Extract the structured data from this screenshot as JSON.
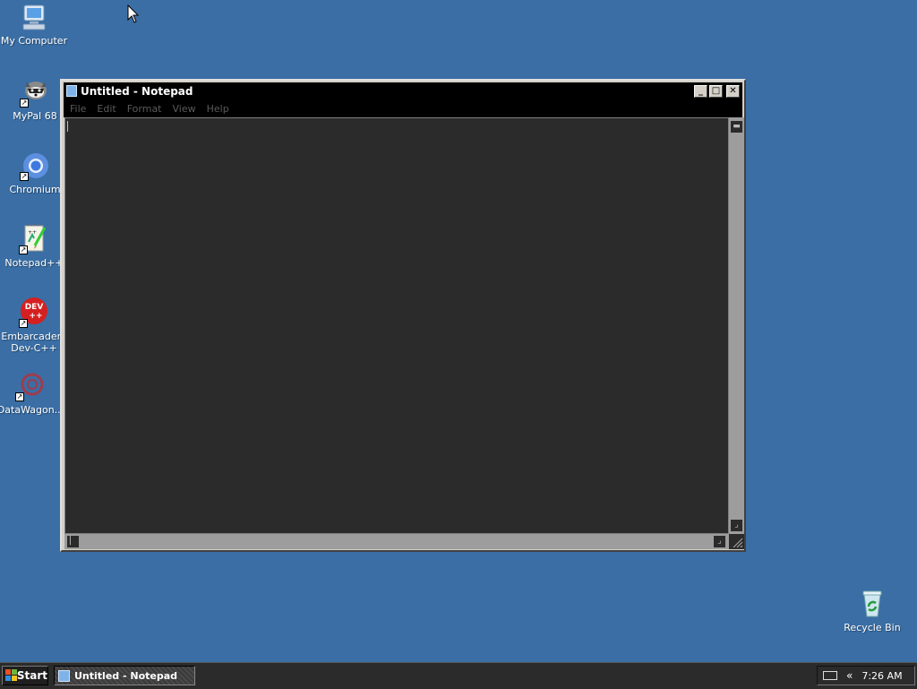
{
  "desktop": {
    "icons": [
      {
        "label": "My Computer",
        "icon": "computer-icon"
      },
      {
        "label": "MyPal 68",
        "icon": "mypal-icon"
      },
      {
        "label": "Chromium",
        "icon": "chromium-icon"
      },
      {
        "label": "Notepad++",
        "icon": "notepadpp-icon"
      },
      {
        "label": "Embarcadero Dev-C++",
        "label_line1": "Embarcadero",
        "label_line2": "Dev-C++",
        "icon": "devcpp-icon",
        "badge": "DEV ++"
      },
      {
        "label": "DataWagon...",
        "icon": "datawagon-icon"
      },
      {
        "label": "Recycle Bin",
        "icon": "recycle-bin-icon"
      }
    ]
  },
  "window": {
    "title": "Untitled - Notepad",
    "menu": [
      "File",
      "Edit",
      "Format",
      "View",
      "Help"
    ],
    "content": "",
    "buttons": {
      "minimize": "_",
      "maximize": "□",
      "close": "✕"
    }
  },
  "taskbar": {
    "start_label": "Start",
    "task_label": "Untitled - Notepad",
    "clock": "7:26 AM",
    "tray_chevron": "«"
  },
  "colors": {
    "desktop": "#3a6ea5",
    "titlebar": "#000000",
    "edit_background": "#2b2b2b",
    "taskbar": "#2b2b2b"
  }
}
